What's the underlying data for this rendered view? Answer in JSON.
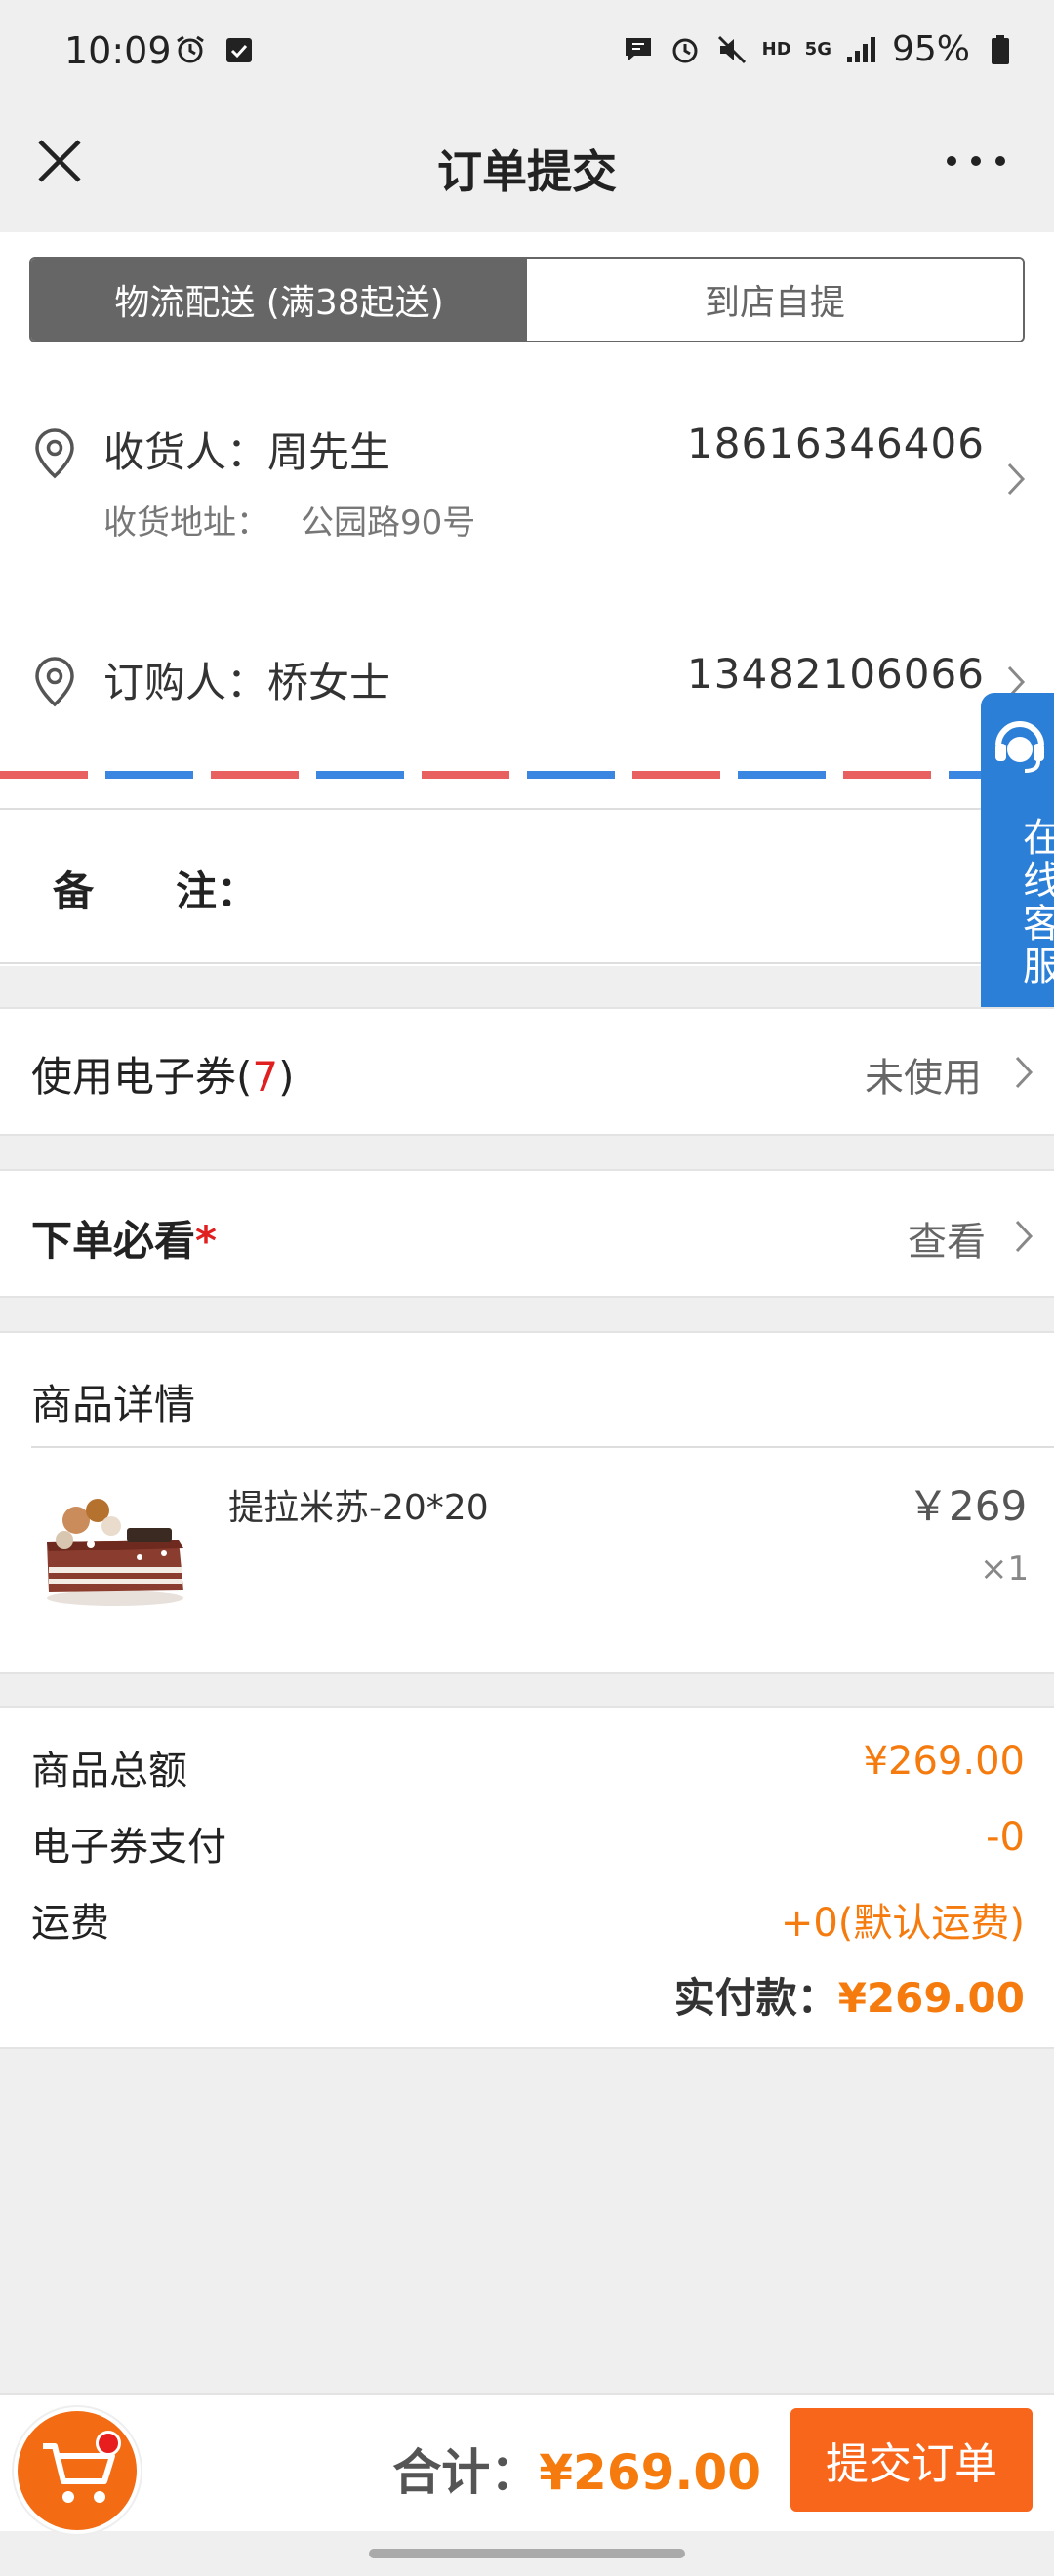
{
  "status_bar": {
    "time": "10:09",
    "network": "5G",
    "hd": "HD",
    "battery": "95%"
  },
  "nav": {
    "title": "订单提交"
  },
  "delivery": {
    "tab_delivery": "物流配送 (满38起送)",
    "tab_pickup": "到店自提"
  },
  "receiver": {
    "label": "收货人：周先生",
    "phone": "18616346406",
    "address_label": "收货地址：",
    "address": "公园路90号"
  },
  "buyer": {
    "label": "订购人：桥女士",
    "phone": "13482106066"
  },
  "remark": {
    "label_a": "备",
    "label_b": "注："
  },
  "coupon": {
    "label": "使用电子券(",
    "count": "7",
    "label_end": ")",
    "status": "未使用"
  },
  "notice": {
    "label": "下单必看",
    "required_mark": "*",
    "action": "查看"
  },
  "product_section": {
    "title": "商品详情",
    "items": [
      {
        "name": "提拉米苏-20*20",
        "price": "￥269",
        "qty": "×1"
      }
    ]
  },
  "summary": {
    "goods_total_label": "商品总额",
    "goods_total": "¥269.00",
    "coupon_pay_label": "电子券支付",
    "coupon_pay": "-0",
    "shipping_label": "运费",
    "shipping": "+0(默认运费)",
    "paid_label": "实付款：",
    "paid": "¥269.00"
  },
  "customer_service": {
    "label": "在线客服"
  },
  "bottom": {
    "total_label": "合计：",
    "total": "¥269.00",
    "submit": "提交订单"
  },
  "colors": {
    "accent": "#f57b0e",
    "submit": "#f8661b",
    "cs_blue": "#2b7fd6",
    "required_red": "#e02020"
  }
}
